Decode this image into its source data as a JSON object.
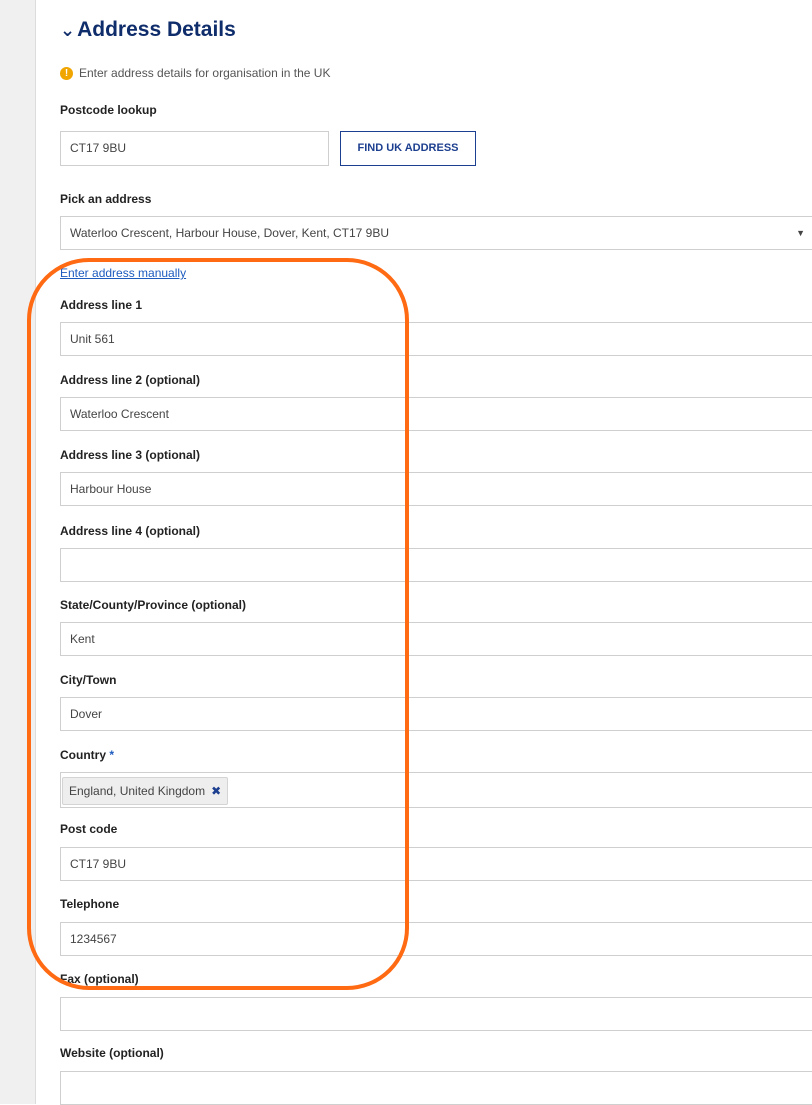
{
  "section": {
    "title": "Address Details",
    "collapse_icon": "chevron-down-icon"
  },
  "info": {
    "icon": "warning-icon",
    "text": "Enter address details for organisation in the UK"
  },
  "postcode_lookup": {
    "label": "Postcode lookup",
    "value": "CT17 9BU",
    "button_label": "FIND UK ADDRESS"
  },
  "pick_address": {
    "label": "Pick an address",
    "selected": "Waterloo Crescent, Harbour House, Dover, Kent, CT17 9BU",
    "arrow": "▼"
  },
  "manual_link": "Enter address manually",
  "fields": {
    "address1": {
      "label": "Address line 1",
      "value": "Unit 561"
    },
    "address2": {
      "label": "Address line 2 (optional)",
      "value": "Waterloo Crescent"
    },
    "address3": {
      "label": "Address line 3 (optional)",
      "value": "Harbour House"
    },
    "address4": {
      "label": "Address line 4 (optional)",
      "value": ""
    },
    "state": {
      "label": "State/County/Province (optional)",
      "value": "Kent"
    },
    "city": {
      "label": "City/Town",
      "value": "Dover"
    },
    "country": {
      "label": "Country",
      "required_mark": "*",
      "tag": "England, United Kingdom",
      "remove_glyph": "✖"
    },
    "postcode": {
      "label": "Post code",
      "value": "CT17 9BU"
    },
    "telephone": {
      "label": "Telephone",
      "value": "1234567"
    },
    "fax": {
      "label": "Fax (optional)",
      "value": ""
    },
    "website": {
      "label": "Website (optional)",
      "value": ""
    }
  },
  "colors": {
    "heading": "#0f2c6b",
    "accent": "#1d3f8f",
    "link": "#1d5bbf",
    "highlight": "#ff6a13",
    "info": "#f0a500"
  }
}
